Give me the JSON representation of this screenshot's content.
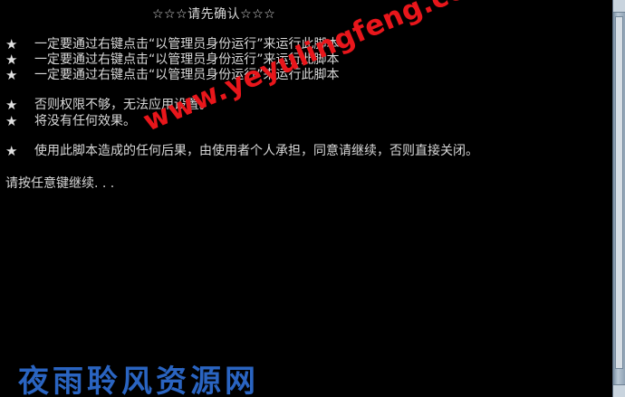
{
  "console": {
    "title": "☆☆☆请先确认☆☆☆",
    "star_glyph": "★",
    "lines": [
      "一定要通过右键点击“以管理员身份运行”来运行此脚本",
      "一定要通过右键点击“以管理员身份运行”来运行此脚本",
      "一定要通过右键点击“以管理员身份运行”来运行此脚本",
      "否则权限不够，无法应用设置。",
      "将没有任何效果。",
      "使用此脚本造成的任何后果，由使用者个人承担，同意请继续，否则直接关闭。"
    ],
    "prompt": "请按任意键继续. . ."
  },
  "watermark": {
    "url": "www.yeyulingfeng.com",
    "logo_text": "夜雨聆风资源网"
  },
  "colors": {
    "background": "#000000",
    "text": "#d8d8d8",
    "watermark_url": "#e8161b",
    "watermark_logo": "#2f6fd6"
  }
}
